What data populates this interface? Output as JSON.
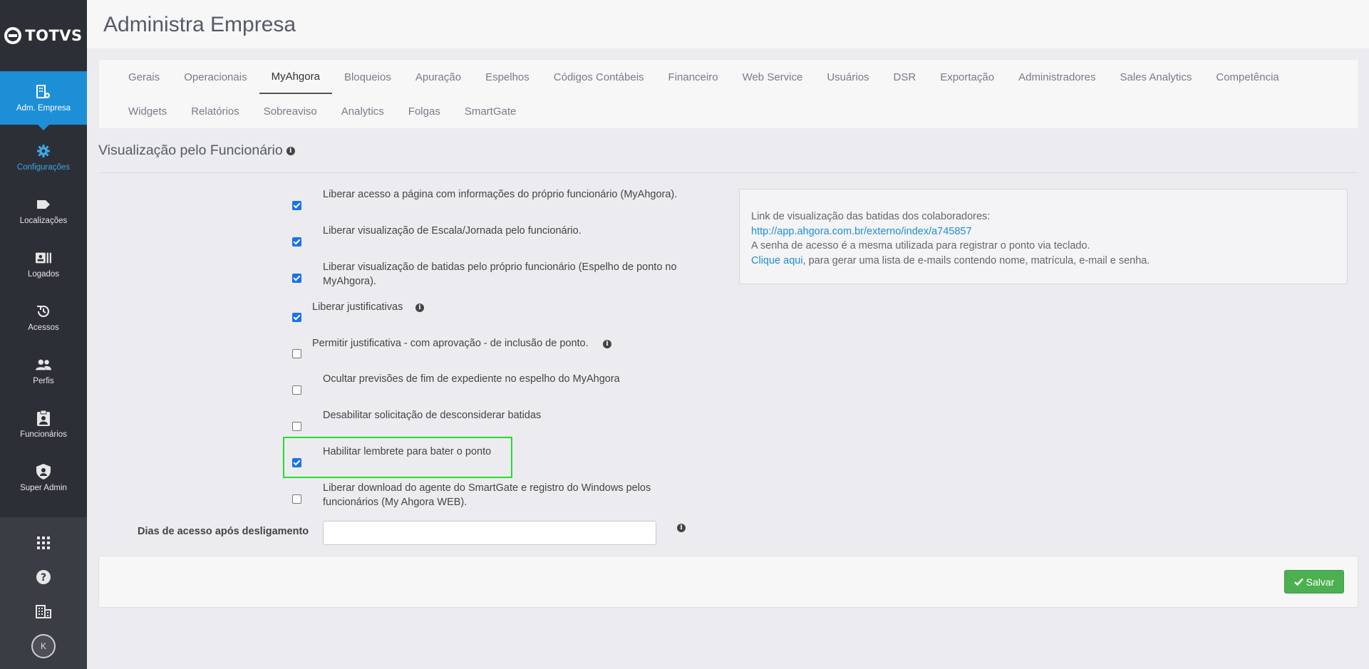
{
  "brand": {
    "name": "TOTVS"
  },
  "sidebar": {
    "items": [
      {
        "label": "Adm. Empresa",
        "icon": "building-gear-icon"
      },
      {
        "label": "Configurações",
        "icon": "gear-icon"
      },
      {
        "label": "Localizações",
        "icon": "tag-icon"
      },
      {
        "label": "Logados",
        "icon": "id-card-icon"
      },
      {
        "label": "Acessos",
        "icon": "history-icon"
      },
      {
        "label": "Perfis",
        "icon": "users-icon"
      },
      {
        "label": "Funcionários",
        "icon": "clipboard-user-icon"
      },
      {
        "label": "Super Admin",
        "icon": "shield-user-icon"
      }
    ],
    "bottom": {
      "apps_icon": "grid-icon",
      "help_icon": "question-circle-icon",
      "company_icon": "building-icon",
      "avatar_initial": "K"
    },
    "active_color": "#1d8fd6"
  },
  "header": {
    "title": "Administra Empresa"
  },
  "tabs": {
    "row1": [
      "Gerais",
      "Operacionais",
      "MyAhgora",
      "Bloqueios",
      "Apuração",
      "Espelhos",
      "Códigos Contábeis",
      "Financeiro",
      "Web Service",
      "Usuários",
      "DSR",
      "Exportação",
      "Administradores",
      "Sales Analytics",
      "Competência"
    ],
    "row2": [
      "Widgets",
      "Relatórios",
      "Sobreaviso",
      "Analytics",
      "Folgas",
      "SmartGate"
    ],
    "active": "MyAhgora"
  },
  "section": {
    "title": "Visualização pelo Funcionário"
  },
  "options": [
    {
      "line1": "Liberar acesso a página com informações do próprio funcionário (MyAhgora).",
      "line2": "",
      "checked": true
    },
    {
      "line1": "Liberar visualização de Escala/Jornada pelo funcionário.",
      "line2": "",
      "checked": true
    },
    {
      "line1": "Liberar visualização de batidas pelo próprio funcionário (Espelho de ponto no",
      "line2": "MyAhgora).",
      "checked": true
    },
    {
      "line1": "Liberar justificativas",
      "line2": "",
      "checked": true
    },
    {
      "line1": "Permitir justificativa - com aprovação - de inclusão de ponto.",
      "line2": "",
      "checked": false
    },
    {
      "line1": "Ocultar previsões de fim de expediente no espelho do MyAhgora",
      "line2": "",
      "checked": false
    },
    {
      "line1": "Desabilitar solicitação de desconsiderar batidas",
      "line2": "",
      "checked": false
    },
    {
      "line1": "Habilitar lembrete para bater o ponto",
      "line2": "",
      "checked": true
    },
    {
      "line1": "Liberar download do agente do SmartGate e registro do Windows pelos",
      "line2": "funcionários (My Ahgora WEB).",
      "checked": false
    }
  ],
  "access_days": {
    "label": "Dias de acesso após desligamento",
    "value": "",
    "placeholder": ""
  },
  "info_panel": {
    "line1": "Link de visualização das batidas dos colaboradores:",
    "link": "http://app.ahgora.com.br/externo/index/a745857",
    "line3": "A senha de acesso é a mesma utilizada para registrar o ponto via teclado.",
    "link2": "Clique aqui",
    "line4_rest": ", para gerar uma lista de e-mails contendo nome, matrícula, e-mail e senha."
  },
  "save": {
    "label": "Salvar",
    "icon": "check-icon",
    "color": "#4cb050"
  },
  "highlight_color": "#22e02a"
}
